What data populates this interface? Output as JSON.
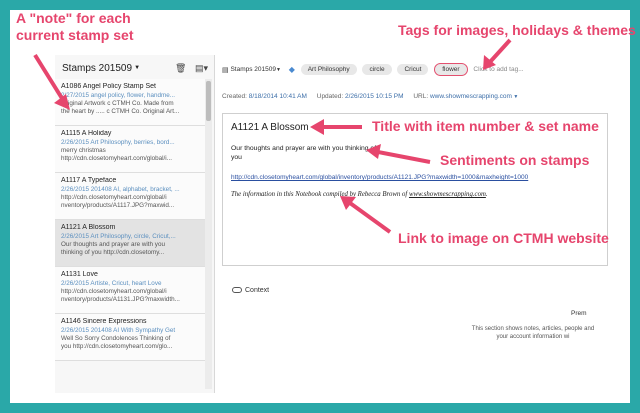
{
  "annotations": {
    "note_per_set_line1": "A \"note\" for each",
    "note_per_set_line2": "current stamp set",
    "tags": "Tags for images, holidays & themes",
    "title": "Title with item number & set name",
    "sentiments": "Sentiments on stamps",
    "link": "Link to image on CTMH website",
    "color": "#e6456d"
  },
  "left": {
    "notebook": "Stamps 201509",
    "icons": [
      "trash-icon",
      "view-options-icon"
    ],
    "notes": [
      {
        "title": "A1086 Angel Policy Stamp Set",
        "date": "2/27/2015",
        "tags": "angel policy, flower, handme...",
        "line2": "Original Artwork c CTMH Co. Made from",
        "line3": "the heart by ..... c CTMH Co. Original Art..."
      },
      {
        "title": "A1115 A Holiday",
        "date": "2/26/2015",
        "tags": "Art Philosophy, berries, bord...",
        "line2": "merry christmas",
        "line3": "http://cdn.closetomyheart.com/global/i..."
      },
      {
        "title": "A1117 A Typeface",
        "date": "2/26/2015",
        "tags": "201408 AI, alphabet, bracket, ...",
        "line2": "http://cdn.closetomyheart.com/global/i",
        "line3": "nventory/products/A1117.JPG?maxwid..."
      },
      {
        "title": "A1121 A Blossom",
        "date": "2/26/2015",
        "tags": "Art Philosophy, circle, Cricut,...",
        "line2": "Our thoughts and prayer are with you",
        "line3": "thinking of you http://cdn.closetomy..."
      },
      {
        "title": "A1131 Love",
        "date": "2/26/2015",
        "tags": "Artiste, Cricut, heart  Love",
        "line2": "http://cdn.closetomyheart.com/global/i",
        "line3": "nventory/products/A1131.JPG?maxwidth..."
      },
      {
        "title": "A1146 Sincere Expressions",
        "date": "2/26/2015",
        "tags": "201408 AI  With Sympathy Get",
        "line2": "Well So Sorry Condolences Thinking of",
        "line3": "you http://cdn.closetomyheart.com/glo..."
      }
    ],
    "selected_index": 3
  },
  "right": {
    "notebook": "Stamps 201509",
    "tags": [
      "Art Philosophy",
      "circle",
      "Cricut",
      "flower"
    ],
    "add_tag": "Click to add tag...",
    "created_label": "Created:",
    "created_value": "8/18/2014 10:41 AM",
    "updated_label": "Updated:",
    "updated_value": "2/26/2015 10:15 PM",
    "url_label": "URL:",
    "url_value": "www.showmescrapping.com",
    "note_title": "A1121 A Blossom",
    "note_body": "Our thoughts and prayer are with you thinking of you",
    "note_link": "http://cdn.closetomyheart.com/global/inventory/products/A1121.JPG?maxwidth=1000&maxheight=1000",
    "credit_prefix": "The information in this Notebook ",
    "credit_mid": "compiled by Rebecca Brown of ",
    "credit_site": "www.showmescrapping.com",
    "credit_end": ".",
    "context": "Context",
    "prem": "Prem",
    "section_line1": "This section shows notes, articles, people and",
    "section_line2": "your account information wi"
  }
}
